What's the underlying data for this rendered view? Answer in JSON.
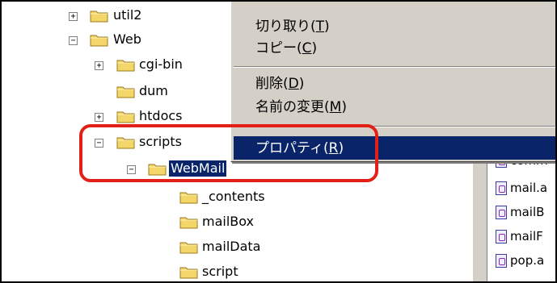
{
  "tree": {
    "rows": [
      {
        "label": "util2",
        "expander": "+"
      },
      {
        "label": "Web",
        "expander": "−"
      },
      {
        "label": "cgi-bin",
        "expander": "+"
      },
      {
        "label": "dum",
        "expander": ""
      },
      {
        "label": "htdocs",
        "expander": "+"
      },
      {
        "label": "scripts",
        "expander": "−"
      },
      {
        "label": "WebMail",
        "expander": "−"
      },
      {
        "label": "_contents",
        "expander": ""
      },
      {
        "label": "mailBox",
        "expander": ""
      },
      {
        "label": "mailData",
        "expander": ""
      },
      {
        "label": "script",
        "expander": ""
      }
    ]
  },
  "context_menu": {
    "cut": {
      "text": "切り取り(",
      "key": "T",
      "end": ")"
    },
    "copy": {
      "text": "コピー(",
      "key": "C",
      "end": ")"
    },
    "delete": {
      "text": "削除(",
      "key": "D",
      "end": ")"
    },
    "rename": {
      "text": "名前の変更(",
      "key": "M",
      "end": ")"
    },
    "properties": {
      "text": "プロパティ(",
      "key": "R",
      "end": ")"
    }
  },
  "file_list": {
    "items": [
      "comm",
      "mail.a",
      "mailB",
      "mailF",
      "pop.a"
    ]
  },
  "colors": {
    "selection": "#0a246a",
    "menu_bg": "#d4d0c8",
    "annotation": "#e32017",
    "folder": "#f4d56a"
  }
}
